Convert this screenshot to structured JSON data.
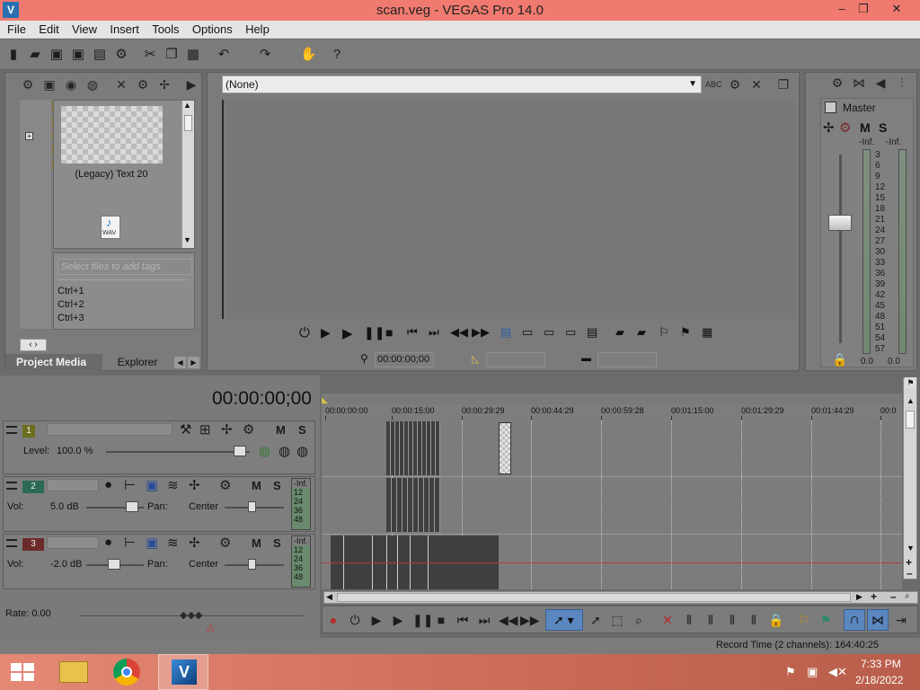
{
  "window": {
    "title": "scan.veg - VEGAS Pro 14.0",
    "min": "–",
    "max": "❐",
    "close": "✕"
  },
  "menu": [
    "File",
    "Edit",
    "View",
    "Insert",
    "Tools",
    "Options",
    "Help"
  ],
  "media": {
    "item_label": "(Legacy) Text 20",
    "wav_label": "WAV",
    "tags_placeholder": "Select files to add tags",
    "shortcuts": [
      "Ctrl+1",
      "Ctrl+2",
      "Ctrl+3"
    ],
    "tabs": [
      "Project Media",
      "Explorer"
    ]
  },
  "preview": {
    "select_value": "(None)",
    "timecode": "00:00:00;00"
  },
  "mixer": {
    "title": "Master",
    "inf_left": "-Inf.",
    "inf_right": "-Inf.",
    "ticks": [
      "3",
      "6",
      "9",
      "12",
      "15",
      "18",
      "21",
      "24",
      "27",
      "30",
      "33",
      "36",
      "39",
      "42",
      "45",
      "48",
      "51",
      "54",
      "57"
    ],
    "value_left": "0.0",
    "value_right": "0.0"
  },
  "timeline": {
    "timecode": "00:00:00;00",
    "ruler": [
      "00:00:00:00",
      "00:00:15:00",
      "00:00:29:29",
      "00:00:44:29",
      "00:00:59:28",
      "00:01:15:00",
      "00:01:29:29",
      "00:01:44:29",
      "00:0"
    ],
    "tracks": [
      {
        "number": "1",
        "type": "video",
        "level_label": "Level:",
        "level_value": "100.0 %"
      },
      {
        "number": "2",
        "type": "audio",
        "vol_label": "Vol:",
        "vol_value": "5.0 dB",
        "pan_label": "Pan:",
        "pan_value": "Center",
        "meter_inf": "-Inf.",
        "meter_ticks": [
          "12",
          "24",
          "36",
          "48"
        ]
      },
      {
        "number": "3",
        "type": "audio",
        "vol_label": "Vol:",
        "vol_value": "-2.0 dB",
        "pan_label": "Pan:",
        "pan_value": "Center",
        "meter_inf": "-Inf.",
        "meter_ticks": [
          "12",
          "24",
          "36",
          "48"
        ]
      }
    ],
    "mute": "M",
    "solo": "S",
    "rate_label": "Rate: 0.00"
  },
  "status": {
    "record_time": "Record Time (2 channels): 164:40:25"
  },
  "taskbar": {
    "time": "7:33 PM",
    "date": "2/18/2022"
  },
  "colors": {
    "titlebar": "#f07a6f",
    "track1": "#6b6d1f",
    "track2": "#2b6b55",
    "track3": "#6b2b2b",
    "clip": "#3f3f3f"
  }
}
